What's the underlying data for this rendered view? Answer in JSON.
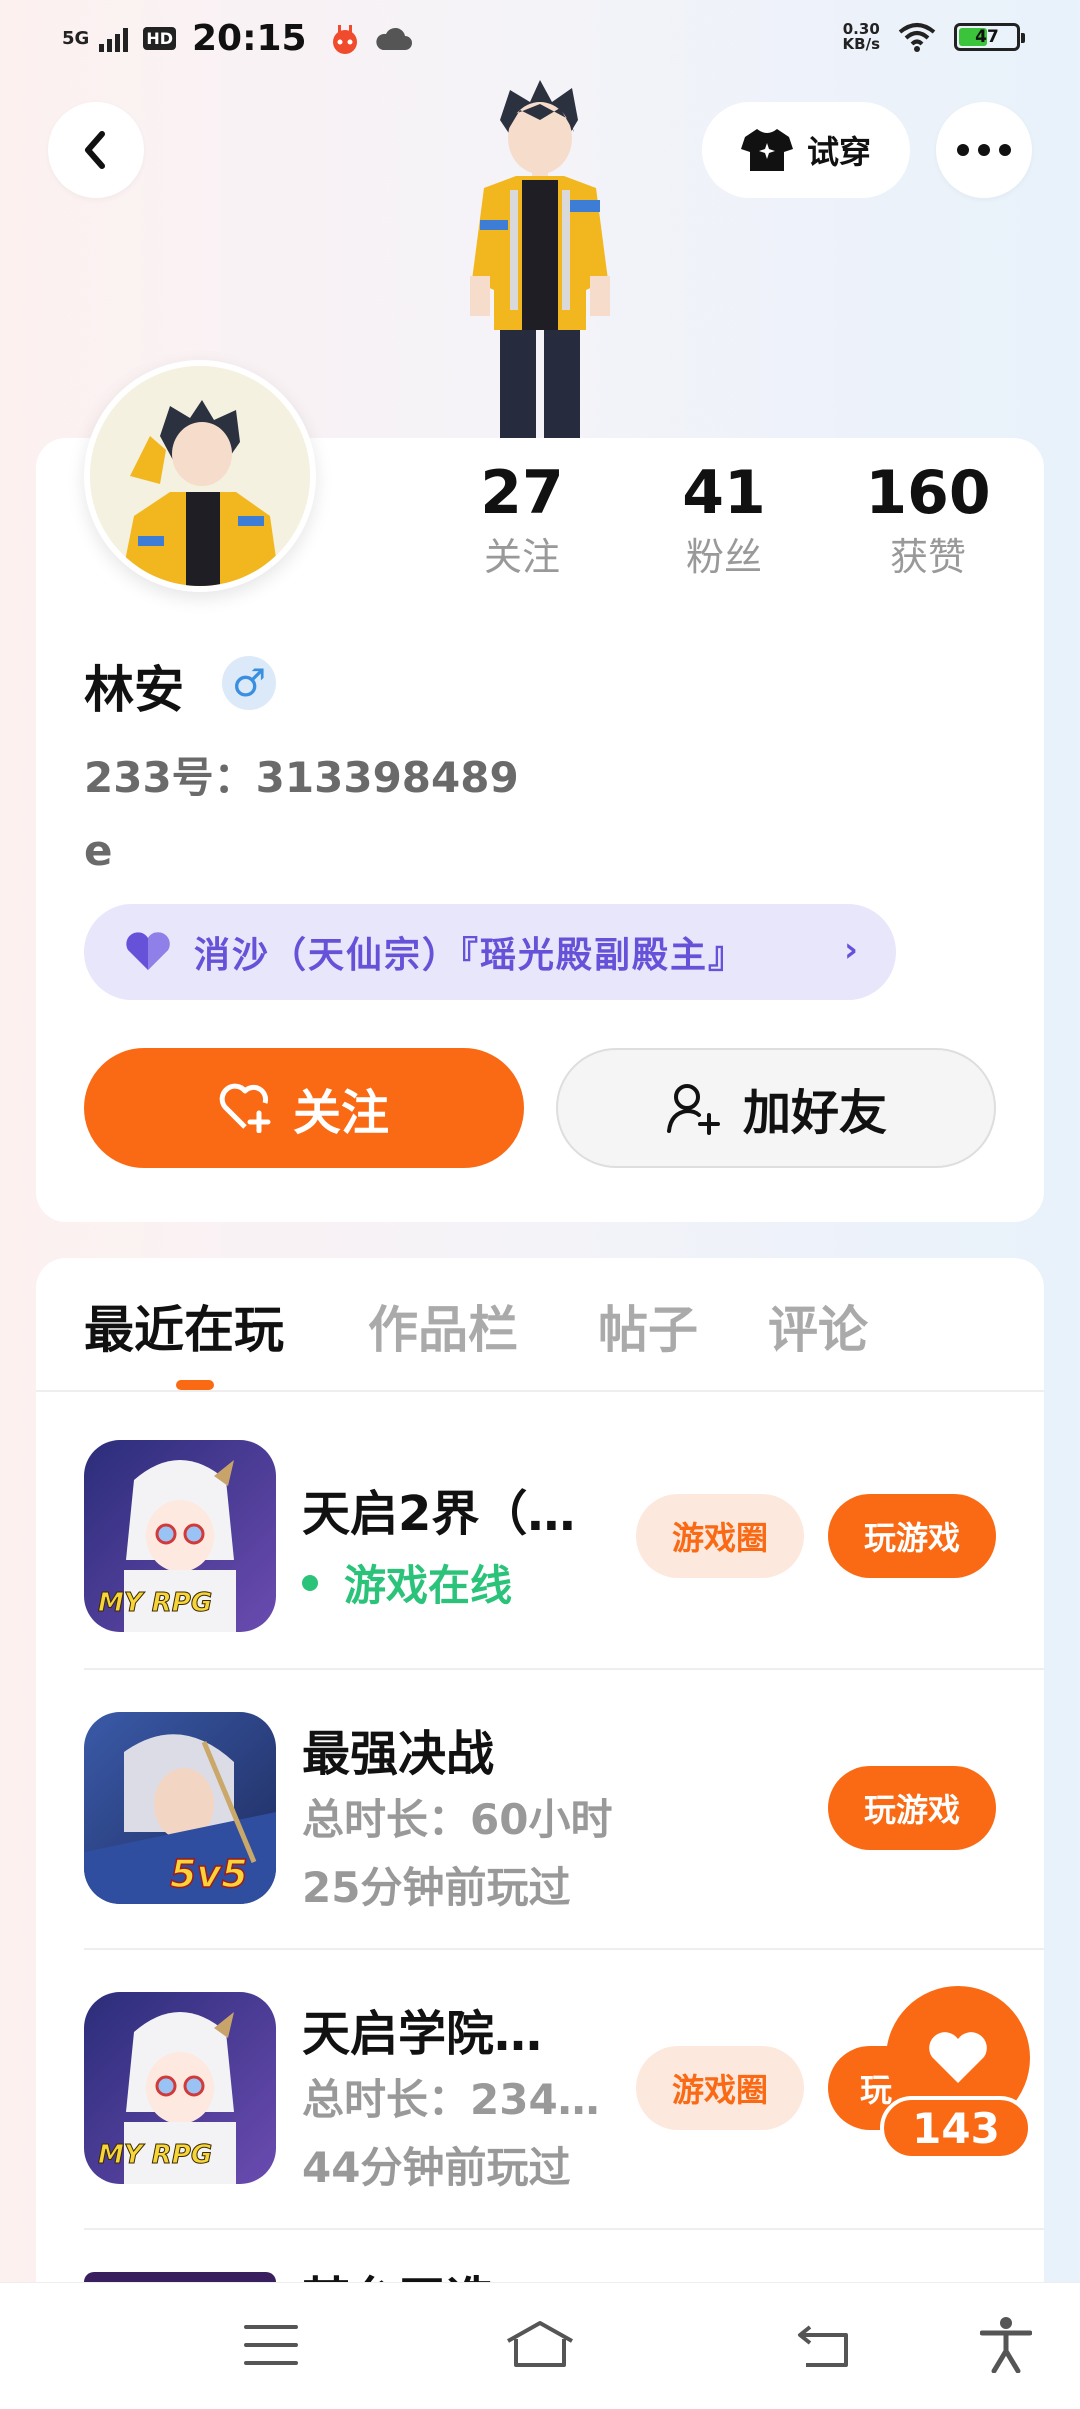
{
  "status_bar": {
    "network": "5G",
    "hd": "HD",
    "time": "20:15",
    "speed_value": "0.30",
    "speed_unit": "KB/s",
    "battery": "47"
  },
  "header": {
    "try_on_label": "试穿"
  },
  "profile": {
    "stats": [
      {
        "value": "27",
        "label": "关注"
      },
      {
        "value": "41",
        "label": "粉丝"
      },
      {
        "value": "160",
        "label": "获赞"
      }
    ],
    "name": "林安",
    "gender_symbol": "♂",
    "uid": "233号：313398489",
    "bio": "e",
    "guild": "消沙（天仙宗）『瑶光殿副殿主』",
    "follow_label": "关注",
    "add_friend_label": "加好友"
  },
  "tabs": [
    "最近在玩",
    "作品栏",
    "帖子",
    "评论"
  ],
  "games": [
    {
      "title": "天启2界（…",
      "status": "游戏在线",
      "circle_label": "游戏圈",
      "play_label": "玩游戏",
      "badge": "MY RPG"
    },
    {
      "title": "最强决战",
      "duration": "总时长：60小时",
      "last_played": "25分钟前玩过",
      "play_label": "玩游戏",
      "badge": "5v5"
    },
    {
      "title": "天启学院…",
      "duration": "总时长：234…",
      "last_played": "44分钟前玩过",
      "circle_label": "游戏圈",
      "play_label": "玩",
      "badge": "MY RPG"
    },
    {
      "title": "某台王造"
    }
  ],
  "likes": "143",
  "colors": {
    "accent": "#fa6a14",
    "guild_bg": "#e7e6fb",
    "guild_text": "#6652d8",
    "online": "#2bc37a"
  }
}
